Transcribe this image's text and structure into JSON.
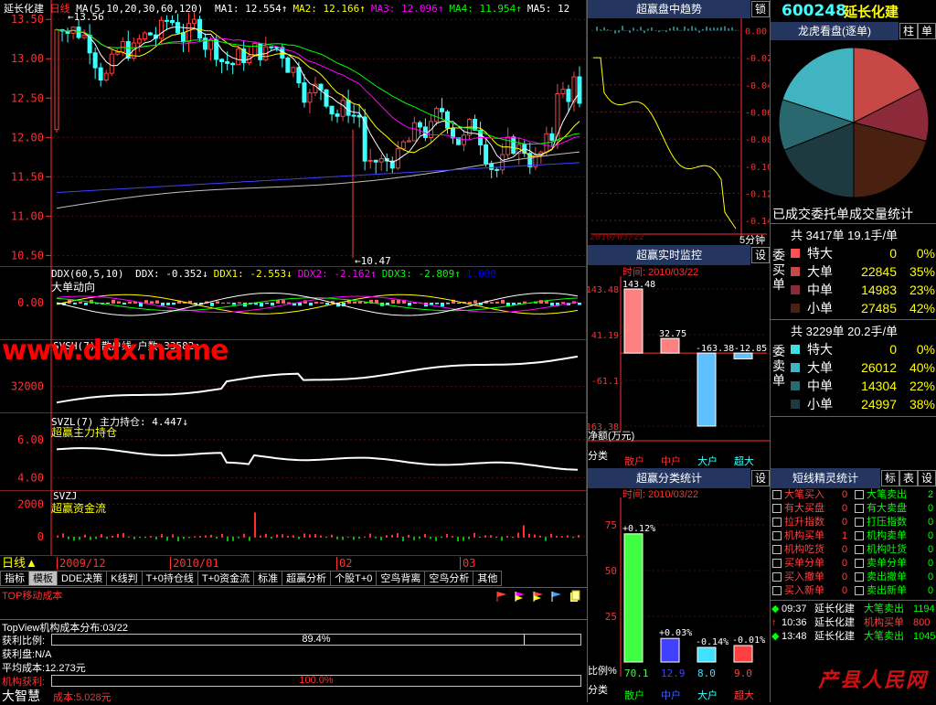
{
  "app": {
    "code": "600248",
    "name": "延长化建",
    "period": "日线",
    "watermark": "www.ddx.name",
    "bottom_brand": "大智慧",
    "logo_text": "产县人民网",
    "cost_footer": "成本:5.028元"
  },
  "kline": {
    "title": "延长化建 日线 MA(5,10,20,30,60,120)",
    "ma_items": [
      {
        "label": "MA1:",
        "value": "12.554↑",
        "color": "#ffffff"
      },
      {
        "label": "MA2:",
        "value": "12.166↑",
        "color": "#ffff00"
      },
      {
        "label": "MA3:",
        "value": "12.096↑",
        "color": "#ff00ff"
      },
      {
        "label": "MA4:",
        "value": "11.954↑",
        "color": "#00ff00"
      },
      {
        "label": "MA5:",
        "value": "12",
        "color": "#ffffff"
      }
    ],
    "y_ticks": [
      "13.50",
      "13.00",
      "12.50",
      "12.00",
      "11.50",
      "11.00",
      "10.50"
    ],
    "high_label": "13.56",
    "low_label": "10.47"
  },
  "ddx": {
    "title": "DDX(60,5,10)",
    "items": [
      {
        "label": "DDX:",
        "value": "-0.352↓",
        "color": "#ffffff"
      },
      {
        "label": "DDX1:",
        "value": "-2.553↓",
        "color": "#ffff00"
      },
      {
        "label": "DDX2:",
        "value": "-2.162↑",
        "color": "#ff00ff"
      },
      {
        "label": "DDX3:",
        "value": "-2.809↑",
        "color": "#00ff00"
      },
      {
        "label": "",
        "value": "1.000",
        "color": "#0000ff"
      }
    ],
    "sub": "大单动向",
    "y_ticks": [
      "0.00"
    ]
  },
  "svsh": {
    "title": "SVSH(7) 散户线 户数:33582↑",
    "y_ticks": [
      "32000"
    ]
  },
  "svzl": {
    "title": "SVZL(7) 主力持仓: 4.447↓",
    "sub": "超赢主力持仓",
    "y_ticks": [
      "6.00",
      "4.00"
    ]
  },
  "svzj": {
    "title": "SVZJ",
    "sub": "超赢资金流",
    "y_ticks": [
      "2000",
      "0"
    ]
  },
  "date_axis": [
    "2009/12",
    "2010/01",
    "02",
    "03"
  ],
  "tabs": [
    "指标",
    "模板",
    "DDE决策",
    "K线判",
    "T+0持仓线",
    "T+0资金流",
    "标准",
    "超赢分析",
    "个股T+0",
    "空鸟背离",
    "空鸟分析",
    "其他"
  ],
  "bottom_panel": {
    "title": "TOP移动成本",
    "topview": "TopView机构成本分布:03/22",
    "rows": [
      {
        "label": "获利比例:",
        "value": "89.4%"
      },
      {
        "label": "获利盘:",
        "value": "N/A"
      },
      {
        "label": "平均成本:",
        "value": "12.273元"
      },
      {
        "label": "机构获利:",
        "value": "100.0%"
      }
    ],
    "profit_fraction": 0.894,
    "inst_fraction": 1.0
  },
  "trend_panel": {
    "title": "超赢盘中趋势",
    "lock": "锁",
    "y_ticks": [
      "0.00",
      "-0.02",
      "-0.04",
      "-0.06",
      "-0.08",
      "-0.10",
      "-0.12",
      "-0.14"
    ],
    "date": "2010/03/22",
    "interval": "5分钟"
  },
  "monitor_panel": {
    "title": "超赢实时监控",
    "setting": "设",
    "time": "时间: 2010/03/22",
    "y_ticks": [
      "143.48",
      "41.19",
      "-61.1",
      "-163.38"
    ],
    "bar_values": [
      "143.48",
      "32.75",
      "-163.38",
      "-12.85"
    ],
    "bars": [
      143.48,
      32.75,
      -163.38,
      -12.85
    ],
    "net_label": "净额(万元)",
    "cat_label": "分类",
    "cats": [
      "散户",
      "中户",
      "大户",
      "超大"
    ]
  },
  "class_panel": {
    "title": "超赢分类统计",
    "setting": "设",
    "time": "时间: 2010/03/22",
    "y_ticks": [
      "75",
      "50",
      "25"
    ],
    "bars": [
      {
        "top": "+0.12%",
        "bottom": "70.1",
        "value": 70.1
      },
      {
        "top": "+0.03%",
        "bottom": "12.9",
        "value": 12.9
      },
      {
        "top": "-0.14%",
        "bottom": "8.0",
        "value": 8.0
      },
      {
        "top": "-0.01%",
        "bottom": "9.0",
        "value": 9.0
      }
    ],
    "ratio_label": "比例%",
    "cat_label": "分类",
    "cats": [
      "散户",
      "中户",
      "大户",
      "超大"
    ]
  },
  "dragon": {
    "title": "龙虎看盘(逐单)",
    "b1": "柱",
    "b2": "单",
    "subtitle": "已成交委托单成交量统计",
    "pie": [
      {
        "name": "buy-big",
        "value": 35,
        "color": "#c84848"
      },
      {
        "name": "buy-mid",
        "value": 23,
        "color": "#8c2a3a"
      },
      {
        "name": "buy-small",
        "value": 42,
        "color": "#4a2010"
      },
      {
        "name": "sell-small",
        "value": 38,
        "color": "#1e3a40"
      },
      {
        "name": "sell-mid",
        "value": 22,
        "color": "#2a6870"
      },
      {
        "name": "sell-big",
        "value": 40,
        "color": "#40b4c0"
      }
    ],
    "buy": {
      "header": "共 3417单 19.1手/单",
      "side": "委买单",
      "rows": [
        {
          "label": "特大",
          "num": "0",
          "pct": "0%",
          "color": "#ff5050"
        },
        {
          "label": "大单",
          "num": "22845",
          "pct": "35%",
          "color": "#c84848"
        },
        {
          "label": "中单",
          "num": "14983",
          "pct": "23%",
          "color": "#8c2a3a"
        },
        {
          "label": "小单",
          "num": "27485",
          "pct": "42%",
          "color": "#4a2010"
        }
      ]
    },
    "sell": {
      "header": "共 3229单 20.2手/单",
      "side": "委卖单",
      "rows": [
        {
          "label": "特大",
          "num": "0",
          "pct": "0%",
          "color": "#40e0e0"
        },
        {
          "label": "大单",
          "num": "26012",
          "pct": "40%",
          "color": "#40b4c0"
        },
        {
          "label": "中单",
          "num": "14304",
          "pct": "22%",
          "color": "#2a6870"
        },
        {
          "label": "小单",
          "num": "24997",
          "pct": "38%",
          "color": "#1e3a40"
        }
      ]
    }
  },
  "signal": {
    "title": "短线精灵统计",
    "b1": "标",
    "b2": "表",
    "b3": "设",
    "left": [
      {
        "label": "大笔买入",
        "count": "0"
      },
      {
        "label": "有大买盘",
        "count": "0"
      },
      {
        "label": "拉升指数",
        "count": "0"
      },
      {
        "label": "机构买单",
        "count": "1"
      },
      {
        "label": "机构吃货",
        "count": "0"
      },
      {
        "label": "买单分单",
        "count": "0"
      },
      {
        "label": "买入撤单",
        "count": "0"
      },
      {
        "label": "买入新单",
        "count": "0"
      }
    ],
    "right": [
      {
        "label": "大笔卖出",
        "count": "2"
      },
      {
        "label": "有大卖盘",
        "count": "0"
      },
      {
        "label": "打压指数",
        "count": "0"
      },
      {
        "label": "机构卖单",
        "count": "0"
      },
      {
        "label": "机构吐货",
        "count": "0"
      },
      {
        "label": "卖单分单",
        "count": "0"
      },
      {
        "label": "卖出撤单",
        "count": "0"
      },
      {
        "label": "卖出新单",
        "count": "0"
      }
    ],
    "events": [
      {
        "icon": "◆",
        "time": "09:37",
        "name": "延长化建",
        "type": "大笔卖出",
        "vol": "1194",
        "color": "#00ff00"
      },
      {
        "icon": "↑",
        "time": "10:36",
        "name": "延长化建",
        "type": "机构买单",
        "vol": "800",
        "color": "#ff4040"
      },
      {
        "icon": "◆",
        "time": "13:48",
        "name": "延长化建",
        "type": "大笔卖出",
        "vol": "1045",
        "color": "#00ff00"
      }
    ]
  }
}
